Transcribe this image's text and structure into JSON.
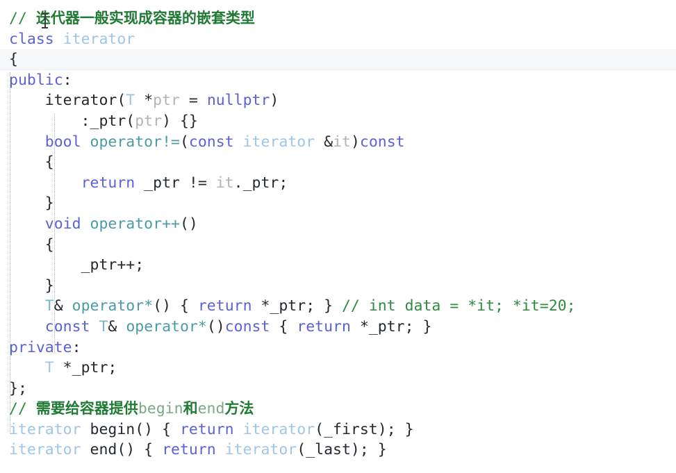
{
  "editor": {
    "language": "cpp",
    "background_color": "#ffffff",
    "highlight_line_color": "#f6f8fa",
    "colors": {
      "keyword": "#5b62d8",
      "type": "#9fc5e8",
      "function": "#4a9ba5",
      "comment": "#2e8b40",
      "plain": "#24292e",
      "dim": "#b0b3b8"
    }
  },
  "code": {
    "lines": [
      {
        "n": 1,
        "highlight": false,
        "tokens": [
          {
            "t": "// ",
            "c": "comment"
          },
          {
            "t": "迭代器一般实现成容器的嵌套类型",
            "c": "comment-cjk"
          }
        ]
      },
      {
        "n": 2,
        "highlight": false,
        "tokens": [
          {
            "t": "class",
            "c": "kw"
          },
          {
            "t": " ",
            "c": "plain"
          },
          {
            "t": "iterator",
            "c": "type"
          }
        ]
      },
      {
        "n": 3,
        "highlight": true,
        "tokens": [
          {
            "t": "{",
            "c": "plain"
          }
        ]
      },
      {
        "n": 4,
        "highlight": false,
        "tokens": [
          {
            "t": "public",
            "c": "kw"
          },
          {
            "t": ":",
            "c": "plain"
          }
        ]
      },
      {
        "n": 5,
        "highlight": false,
        "tokens": [
          {
            "t": "    iterator(",
            "c": "plain"
          },
          {
            "t": "T",
            "c": "type"
          },
          {
            "t": " *",
            "c": "plain"
          },
          {
            "t": "ptr",
            "c": "dim"
          },
          {
            "t": " = ",
            "c": "plain"
          },
          {
            "t": "nullptr",
            "c": "kw"
          },
          {
            "t": ")",
            "c": "plain"
          }
        ]
      },
      {
        "n": 6,
        "highlight": false,
        "tokens": [
          {
            "t": "        :_ptr(",
            "c": "plain"
          },
          {
            "t": "ptr",
            "c": "dim"
          },
          {
            "t": ") {}",
            "c": "plain"
          }
        ]
      },
      {
        "n": 7,
        "highlight": false,
        "tokens": [
          {
            "t": "    ",
            "c": "plain"
          },
          {
            "t": "bool",
            "c": "kw"
          },
          {
            "t": " ",
            "c": "plain"
          },
          {
            "t": "operator!=",
            "c": "fn"
          },
          {
            "t": "(",
            "c": "plain"
          },
          {
            "t": "const",
            "c": "kw"
          },
          {
            "t": " ",
            "c": "plain"
          },
          {
            "t": "iterator",
            "c": "type"
          },
          {
            "t": " &",
            "c": "plain"
          },
          {
            "t": "it",
            "c": "dim"
          },
          {
            "t": ")",
            "c": "plain"
          },
          {
            "t": "const",
            "c": "kw"
          }
        ]
      },
      {
        "n": 8,
        "highlight": false,
        "tokens": [
          {
            "t": "    {",
            "c": "plain"
          }
        ]
      },
      {
        "n": 9,
        "highlight": false,
        "tokens": [
          {
            "t": "        ",
            "c": "plain"
          },
          {
            "t": "return",
            "c": "kw"
          },
          {
            "t": " _ptr != ",
            "c": "plain"
          },
          {
            "t": "it",
            "c": "dim"
          },
          {
            "t": "._ptr;",
            "c": "plain"
          }
        ]
      },
      {
        "n": 10,
        "highlight": false,
        "tokens": [
          {
            "t": "    }",
            "c": "plain"
          }
        ]
      },
      {
        "n": 11,
        "highlight": false,
        "tokens": [
          {
            "t": "    ",
            "c": "plain"
          },
          {
            "t": "void",
            "c": "kw"
          },
          {
            "t": " ",
            "c": "plain"
          },
          {
            "t": "operator++",
            "c": "fn"
          },
          {
            "t": "()",
            "c": "plain"
          }
        ]
      },
      {
        "n": 12,
        "highlight": false,
        "tokens": [
          {
            "t": "    {",
            "c": "plain"
          }
        ]
      },
      {
        "n": 13,
        "highlight": false,
        "tokens": [
          {
            "t": "        _ptr++;",
            "c": "plain"
          }
        ]
      },
      {
        "n": 14,
        "highlight": false,
        "tokens": [
          {
            "t": "    }",
            "c": "plain"
          }
        ]
      },
      {
        "n": 15,
        "highlight": false,
        "tokens": [
          {
            "t": "    ",
            "c": "plain"
          },
          {
            "t": "T",
            "c": "type2"
          },
          {
            "t": "& ",
            "c": "plain"
          },
          {
            "t": "operator*",
            "c": "fn"
          },
          {
            "t": "() { ",
            "c": "plain"
          },
          {
            "t": "return",
            "c": "kw"
          },
          {
            "t": " *_ptr; } ",
            "c": "plain"
          },
          {
            "t": "// int data = *it; *it=20;",
            "c": "comment"
          }
        ]
      },
      {
        "n": 16,
        "highlight": false,
        "tokens": [
          {
            "t": "    ",
            "c": "plain"
          },
          {
            "t": "const",
            "c": "kw"
          },
          {
            "t": " ",
            "c": "plain"
          },
          {
            "t": "T",
            "c": "type2"
          },
          {
            "t": "& ",
            "c": "plain"
          },
          {
            "t": "operator*",
            "c": "fn"
          },
          {
            "t": "()",
            "c": "plain"
          },
          {
            "t": "const",
            "c": "kw"
          },
          {
            "t": " { ",
            "c": "plain"
          },
          {
            "t": "return",
            "c": "kw"
          },
          {
            "t": " *_ptr; }",
            "c": "plain"
          }
        ]
      },
      {
        "n": 17,
        "highlight": false,
        "tokens": [
          {
            "t": "private",
            "c": "kw"
          },
          {
            "t": ":",
            "c": "plain"
          }
        ]
      },
      {
        "n": 18,
        "highlight": false,
        "tokens": [
          {
            "t": "    ",
            "c": "plain"
          },
          {
            "t": "T",
            "c": "type"
          },
          {
            "t": " *_ptr;",
            "c": "plain"
          }
        ]
      },
      {
        "n": 19,
        "highlight": false,
        "tokens": [
          {
            "t": "};",
            "c": "plain"
          }
        ]
      },
      {
        "n": 20,
        "highlight": false,
        "tokens": [
          {
            "t": "// ",
            "c": "comment"
          },
          {
            "t": "需要给容器提供",
            "c": "comment-cjk"
          },
          {
            "t": "begin",
            "c": "comment-lat"
          },
          {
            "t": "和",
            "c": "comment-cjk"
          },
          {
            "t": "end",
            "c": "comment-lat"
          },
          {
            "t": "方法",
            "c": "comment-cjk"
          }
        ]
      },
      {
        "n": 21,
        "highlight": false,
        "tokens": [
          {
            "t": "iterator",
            "c": "type"
          },
          {
            "t": " begin() { ",
            "c": "plain"
          },
          {
            "t": "return",
            "c": "kw"
          },
          {
            "t": " ",
            "c": "plain"
          },
          {
            "t": "iterator",
            "c": "type"
          },
          {
            "t": "(_first); }",
            "c": "plain"
          }
        ]
      },
      {
        "n": 22,
        "highlight": false,
        "tokens": [
          {
            "t": "iterator",
            "c": "type"
          },
          {
            "t": " end() { ",
            "c": "plain"
          },
          {
            "t": "return",
            "c": "kw"
          },
          {
            "t": " ",
            "c": "plain"
          },
          {
            "t": "iterator",
            "c": "type"
          },
          {
            "t": "(_last); }",
            "c": "plain"
          }
        ]
      }
    ]
  },
  "cursor": {
    "shape": "i-beam-text-cursor"
  }
}
